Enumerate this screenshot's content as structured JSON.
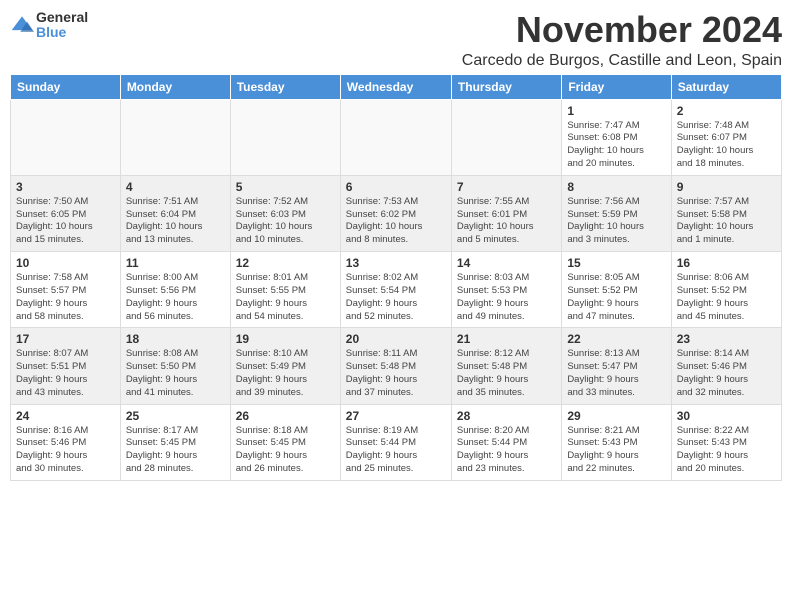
{
  "logo": {
    "general": "General",
    "blue": "Blue"
  },
  "title": "November 2024",
  "location": "Carcedo de Burgos, Castille and Leon, Spain",
  "weekdays": [
    "Sunday",
    "Monday",
    "Tuesday",
    "Wednesday",
    "Thursday",
    "Friday",
    "Saturday"
  ],
  "weeks": [
    [
      {
        "day": "",
        "info": ""
      },
      {
        "day": "",
        "info": ""
      },
      {
        "day": "",
        "info": ""
      },
      {
        "day": "",
        "info": ""
      },
      {
        "day": "",
        "info": ""
      },
      {
        "day": "1",
        "info": "Sunrise: 7:47 AM\nSunset: 6:08 PM\nDaylight: 10 hours\nand 20 minutes."
      },
      {
        "day": "2",
        "info": "Sunrise: 7:48 AM\nSunset: 6:07 PM\nDaylight: 10 hours\nand 18 minutes."
      }
    ],
    [
      {
        "day": "3",
        "info": "Sunrise: 7:50 AM\nSunset: 6:05 PM\nDaylight: 10 hours\nand 15 minutes."
      },
      {
        "day": "4",
        "info": "Sunrise: 7:51 AM\nSunset: 6:04 PM\nDaylight: 10 hours\nand 13 minutes."
      },
      {
        "day": "5",
        "info": "Sunrise: 7:52 AM\nSunset: 6:03 PM\nDaylight: 10 hours\nand 10 minutes."
      },
      {
        "day": "6",
        "info": "Sunrise: 7:53 AM\nSunset: 6:02 PM\nDaylight: 10 hours\nand 8 minutes."
      },
      {
        "day": "7",
        "info": "Sunrise: 7:55 AM\nSunset: 6:01 PM\nDaylight: 10 hours\nand 5 minutes."
      },
      {
        "day": "8",
        "info": "Sunrise: 7:56 AM\nSunset: 5:59 PM\nDaylight: 10 hours\nand 3 minutes."
      },
      {
        "day": "9",
        "info": "Sunrise: 7:57 AM\nSunset: 5:58 PM\nDaylight: 10 hours\nand 1 minute."
      }
    ],
    [
      {
        "day": "10",
        "info": "Sunrise: 7:58 AM\nSunset: 5:57 PM\nDaylight: 9 hours\nand 58 minutes."
      },
      {
        "day": "11",
        "info": "Sunrise: 8:00 AM\nSunset: 5:56 PM\nDaylight: 9 hours\nand 56 minutes."
      },
      {
        "day": "12",
        "info": "Sunrise: 8:01 AM\nSunset: 5:55 PM\nDaylight: 9 hours\nand 54 minutes."
      },
      {
        "day": "13",
        "info": "Sunrise: 8:02 AM\nSunset: 5:54 PM\nDaylight: 9 hours\nand 52 minutes."
      },
      {
        "day": "14",
        "info": "Sunrise: 8:03 AM\nSunset: 5:53 PM\nDaylight: 9 hours\nand 49 minutes."
      },
      {
        "day": "15",
        "info": "Sunrise: 8:05 AM\nSunset: 5:52 PM\nDaylight: 9 hours\nand 47 minutes."
      },
      {
        "day": "16",
        "info": "Sunrise: 8:06 AM\nSunset: 5:52 PM\nDaylight: 9 hours\nand 45 minutes."
      }
    ],
    [
      {
        "day": "17",
        "info": "Sunrise: 8:07 AM\nSunset: 5:51 PM\nDaylight: 9 hours\nand 43 minutes."
      },
      {
        "day": "18",
        "info": "Sunrise: 8:08 AM\nSunset: 5:50 PM\nDaylight: 9 hours\nand 41 minutes."
      },
      {
        "day": "19",
        "info": "Sunrise: 8:10 AM\nSunset: 5:49 PM\nDaylight: 9 hours\nand 39 minutes."
      },
      {
        "day": "20",
        "info": "Sunrise: 8:11 AM\nSunset: 5:48 PM\nDaylight: 9 hours\nand 37 minutes."
      },
      {
        "day": "21",
        "info": "Sunrise: 8:12 AM\nSunset: 5:48 PM\nDaylight: 9 hours\nand 35 minutes."
      },
      {
        "day": "22",
        "info": "Sunrise: 8:13 AM\nSunset: 5:47 PM\nDaylight: 9 hours\nand 33 minutes."
      },
      {
        "day": "23",
        "info": "Sunrise: 8:14 AM\nSunset: 5:46 PM\nDaylight: 9 hours\nand 32 minutes."
      }
    ],
    [
      {
        "day": "24",
        "info": "Sunrise: 8:16 AM\nSunset: 5:46 PM\nDaylight: 9 hours\nand 30 minutes."
      },
      {
        "day": "25",
        "info": "Sunrise: 8:17 AM\nSunset: 5:45 PM\nDaylight: 9 hours\nand 28 minutes."
      },
      {
        "day": "26",
        "info": "Sunrise: 8:18 AM\nSunset: 5:45 PM\nDaylight: 9 hours\nand 26 minutes."
      },
      {
        "day": "27",
        "info": "Sunrise: 8:19 AM\nSunset: 5:44 PM\nDaylight: 9 hours\nand 25 minutes."
      },
      {
        "day": "28",
        "info": "Sunrise: 8:20 AM\nSunset: 5:44 PM\nDaylight: 9 hours\nand 23 minutes."
      },
      {
        "day": "29",
        "info": "Sunrise: 8:21 AM\nSunset: 5:43 PM\nDaylight: 9 hours\nand 22 minutes."
      },
      {
        "day": "30",
        "info": "Sunrise: 8:22 AM\nSunset: 5:43 PM\nDaylight: 9 hours\nand 20 minutes."
      }
    ]
  ]
}
